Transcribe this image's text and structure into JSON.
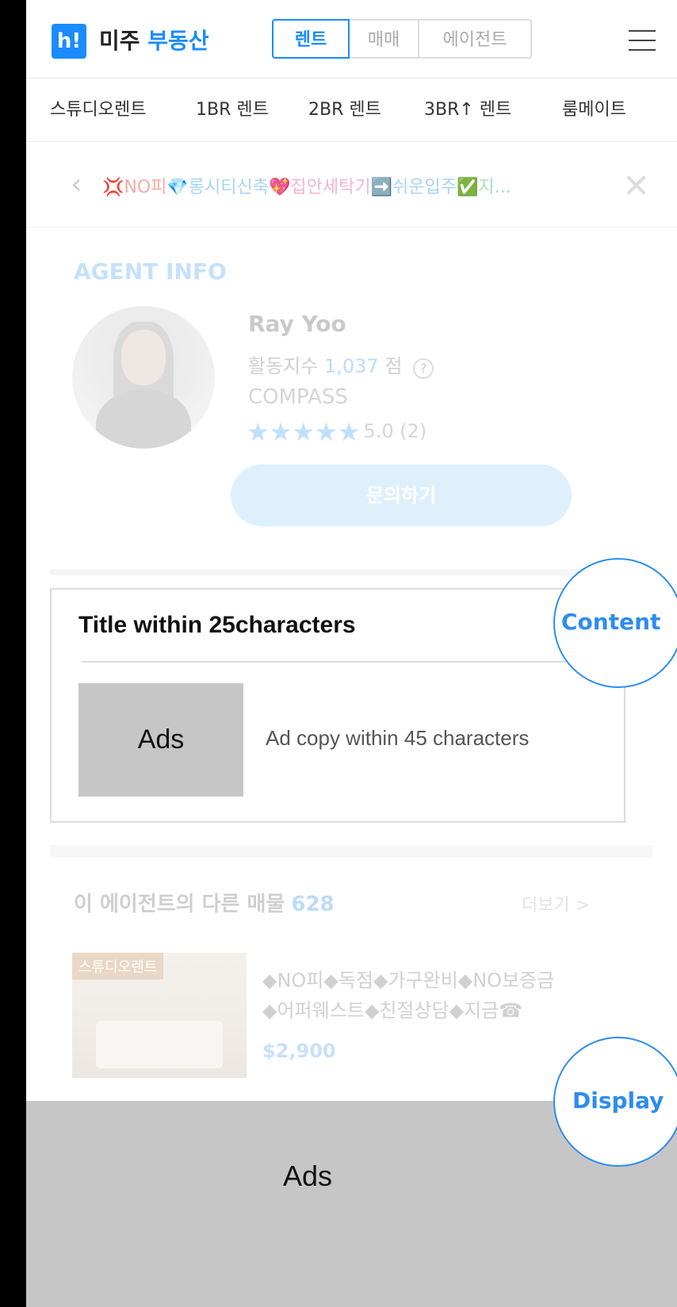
{
  "header": {
    "logo_text": "h!",
    "brand_part1": "미주",
    "brand_part2": "부동산",
    "tabs": [
      {
        "label": "렌트",
        "active": true
      },
      {
        "label": "매매",
        "active": false
      },
      {
        "label": "에이전트",
        "active": false
      }
    ],
    "menu_icon": "hamburger-menu-icon"
  },
  "nav": {
    "items": [
      "스튜디오렌트",
      "1BR 렌트",
      "2BR 렌트",
      "3BR↑ 렌트",
      "룸메이트"
    ]
  },
  "post": {
    "title_parts": [
      "💢NO피",
      "💎롱시티신축",
      "💖집안세탁기",
      "➡️쉬운입주",
      "✅지..."
    ]
  },
  "agent": {
    "section_label": "AGENT INFO",
    "name": "Ray Yoo",
    "activity_label": "활동지수",
    "activity_value": "1,037",
    "activity_unit": "점",
    "help_symbol": "?",
    "company": "COMPASS",
    "stars": "★★★★★",
    "rating": "5.0 (2)",
    "contact_button": "문의하기"
  },
  "native_ad": {
    "title": "Title within 25characters",
    "image_label": "Ads",
    "copy": "Ad copy within 45 characters",
    "bubble_label": "Content"
  },
  "other_listings": {
    "label": "이 에이전트의 다른 매물",
    "count": "628",
    "more_link": "더보기 >",
    "listing": {
      "tag": "스튜디오렌트",
      "line1": "◆NO피◆독점◆가구완비◆NO보증금",
      "line2": "◆어퍼웨스트◆친절상담◆지금☎",
      "price": "$2,900"
    }
  },
  "bottom_ad": {
    "label": "Ads",
    "bubble_label": "Display"
  },
  "colors": {
    "accent": "#1a8cff",
    "bubble_border": "#2d8cf0",
    "ad_placeholder": "#c6c6c6"
  }
}
